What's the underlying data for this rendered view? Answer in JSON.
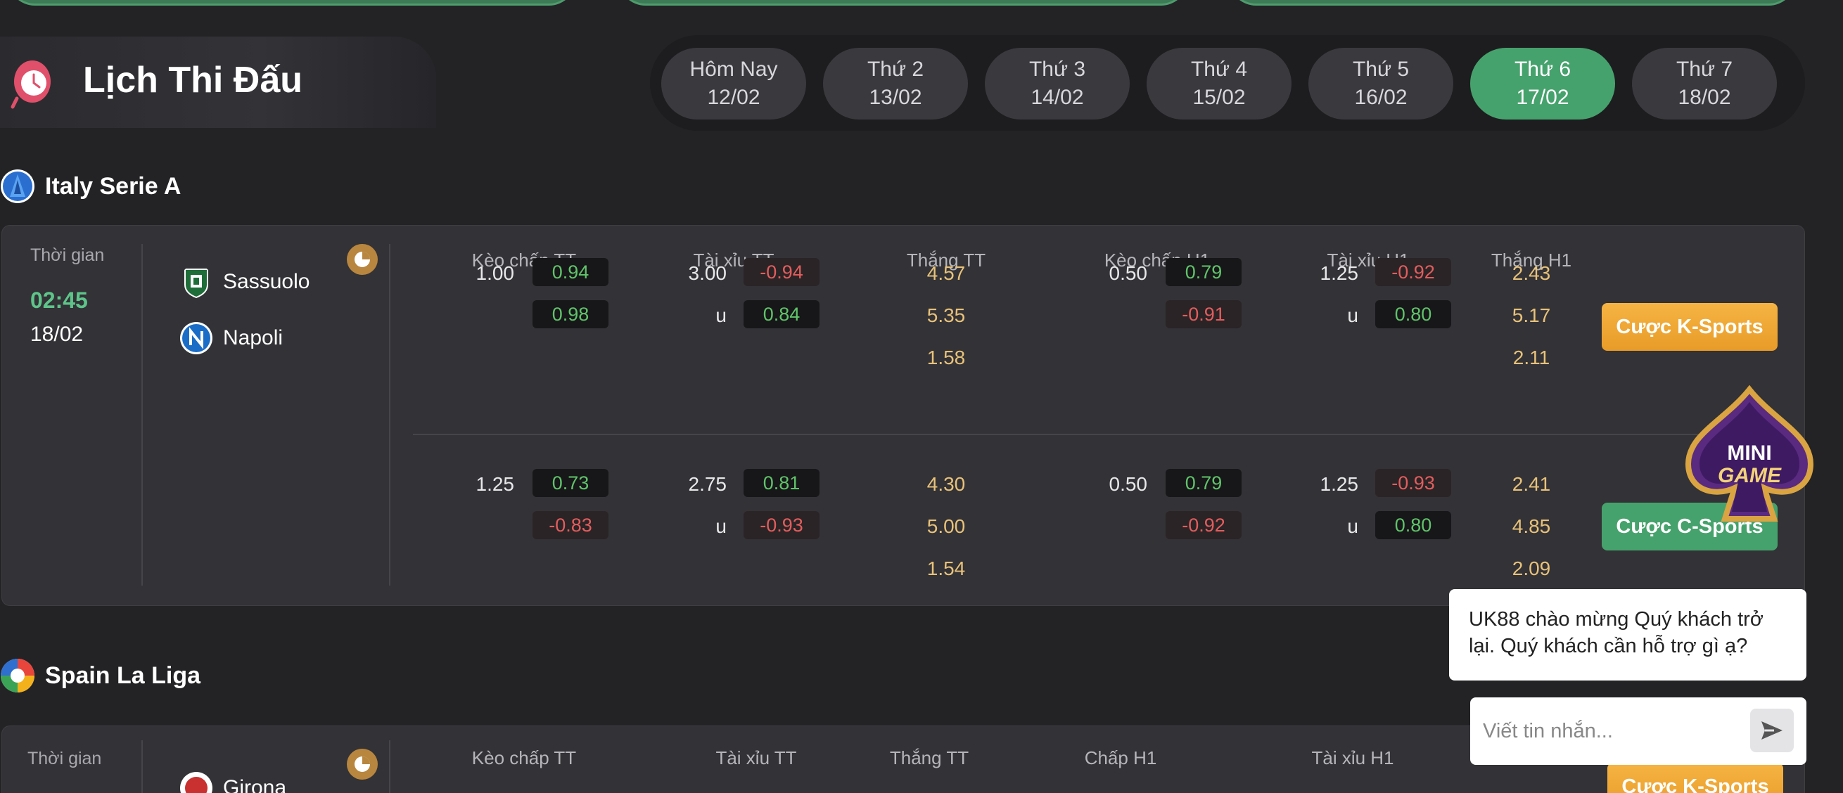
{
  "header": {
    "title": "Lịch Thi Đấu",
    "days": [
      {
        "name": "Hôm Nay",
        "date": "12/02",
        "active": false
      },
      {
        "name": "Thứ 2",
        "date": "13/02",
        "active": false
      },
      {
        "name": "Thứ 3",
        "date": "14/02",
        "active": false
      },
      {
        "name": "Thứ 4",
        "date": "15/02",
        "active": false
      },
      {
        "name": "Thứ 5",
        "date": "16/02",
        "active": false
      },
      {
        "name": "Thứ 6",
        "date": "17/02",
        "active": true
      },
      {
        "name": "Thứ 7",
        "date": "18/02",
        "active": false
      }
    ]
  },
  "leagues": [
    {
      "name": "Italy Serie A",
      "match": {
        "time_label": "Thời gian",
        "time": "02:45",
        "date": "18/02",
        "home": "Sassuolo",
        "away": "Napoli",
        "columns": [
          "Kèo chấp TT",
          "Tài xỉu TT",
          "Thắng TT",
          "Kèo chấp H1",
          "Tài xỉu H1",
          "Thắng H1"
        ],
        "rows": [
          {
            "hdp": "1.00",
            "hdp_home": "0.94",
            "hdp_away": "0.98",
            "ou": "3.00",
            "ou_over": "-0.94",
            "ou_u": "u",
            "ou_under": "0.84",
            "win": [
              "4.57",
              "5.35",
              "1.58"
            ],
            "h1_hdp": "0.50",
            "h1_hdp_home": "0.79",
            "h1_hdp_away": "-0.91",
            "h1_ou": "1.25",
            "h1_ou_over": "-0.92",
            "h1_ou_u": "u",
            "h1_ou_under": "0.80",
            "h1_win": [
              "2.43",
              "5.17",
              "2.11"
            ]
          },
          {
            "hdp": "1.25",
            "hdp_home": "0.73",
            "hdp_away": "-0.83",
            "ou": "2.75",
            "ou_over": "0.81",
            "ou_u": "u",
            "ou_under": "-0.93",
            "win": [
              "4.30",
              "5.00",
              "1.54"
            ],
            "h1_hdp": "0.50",
            "h1_hdp_home": "0.79",
            "h1_hdp_away": "-0.92",
            "h1_ou": "1.25",
            "h1_ou_over": "-0.93",
            "h1_ou_u": "u",
            "h1_ou_under": "0.80",
            "h1_win": [
              "2.41",
              "4.85",
              "2.09"
            ]
          }
        ],
        "btn_k": "Cược K-Sports",
        "btn_c": "Cược C-Sports"
      }
    },
    {
      "name": "Spain La Liga",
      "match": {
        "time_label": "Thời gian",
        "home": "Girona",
        "columns": [
          "Kèo chấp TT",
          "Tài xỉu TT",
          "Thắng TT",
          "Chấp H1",
          "Tài xỉu H1"
        ],
        "btn_k": "Cược K-Sports"
      }
    }
  ],
  "chat": {
    "message": "UK88 chào mừng Quý khách trở lại. Quý khách cần hỗ trợ gì ạ?",
    "placeholder": "Viết tin nhắn..."
  },
  "minigame": {
    "label": "MINI GAME"
  },
  "colors": {
    "accent_green": "#46a26c",
    "accent_orange": "#f0a935",
    "positive": "#60c46a",
    "negative": "#e35d5d",
    "win_odds": "#e8c27a"
  }
}
